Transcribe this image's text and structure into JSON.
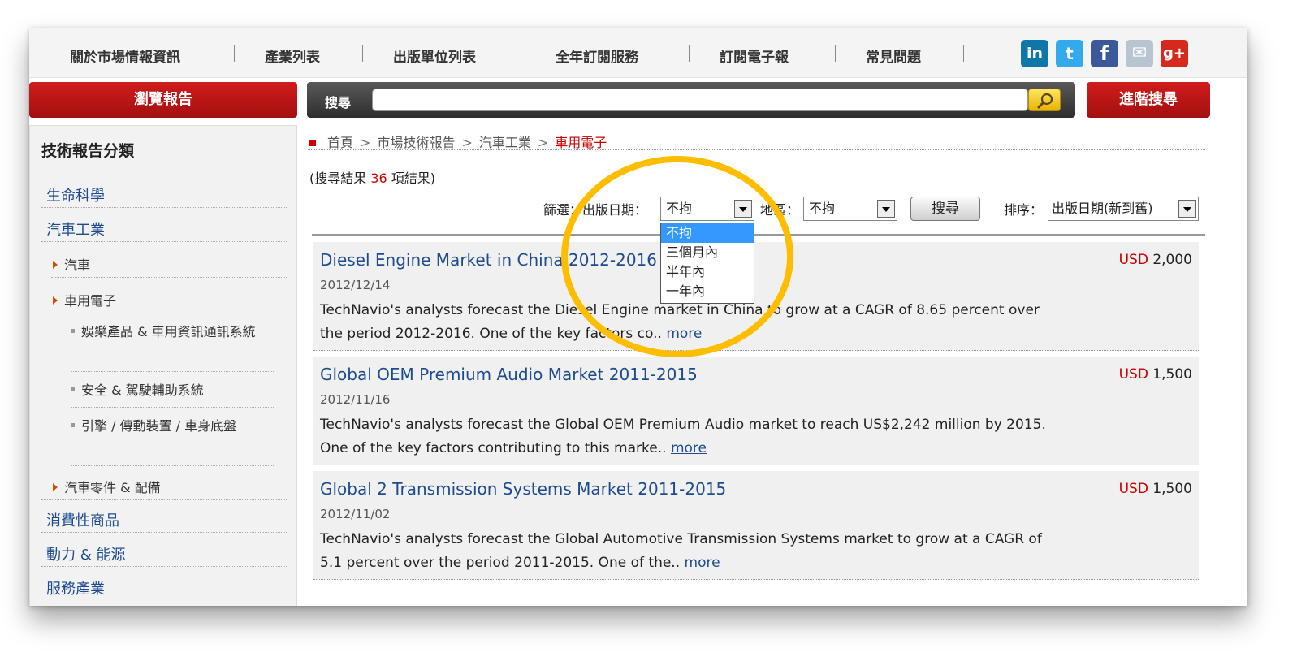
{
  "nav": {
    "items": [
      "關於市場情報資訊",
      "產業列表",
      "出版單位列表",
      "全年訂閱服務",
      "訂閱電子報",
      "常見問題"
    ],
    "social": [
      {
        "name": "linkedin-icon",
        "glyph": "in",
        "color": "#0e76a8"
      },
      {
        "name": "twitter-icon",
        "glyph": "t",
        "color": "#33aaee"
      },
      {
        "name": "facebook-icon",
        "glyph": "f",
        "color": "#3b5998"
      },
      {
        "name": "mail-icon",
        "glyph": "✉",
        "color": "#b8c4d0"
      },
      {
        "name": "google-plus-icon",
        "glyph": "g+",
        "color": "#d6281c"
      }
    ]
  },
  "toolbar": {
    "browse_label": "瀏覽報告",
    "search_label": "搜尋",
    "search_value": "",
    "advanced_label": "進階搜尋"
  },
  "sidebar": {
    "title": "技術報告分類",
    "cat_life": "生命科學",
    "cat_auto": "汽車工業",
    "sub_car": "汽車",
    "sub_elec": "車用電子",
    "sub2_media": "娛樂產品 & 車用資訊通訊系統",
    "sub2_safety": "安全 & 駕駛輔助系統",
    "sub2_engine": "引擎 / 傳動裝置 / 車身底盤",
    "sub_parts": "汽車零件 & 配備",
    "cat_consumer": "消費性商品",
    "cat_power": "動力 & 能源",
    "cat_service": "服務產業"
  },
  "breadcrumb": {
    "home": "首頁",
    "sep": ">",
    "level1": "市場技術報告",
    "level2": "汽車工業",
    "current": "車用電子"
  },
  "results": {
    "count_prefix": "(搜尋結果",
    "count": "36",
    "count_suffix": "項結果)"
  },
  "filter": {
    "label": "篩選：出版日期：",
    "date_value": "不拘",
    "region_label": "地區：",
    "region_value": "不拘",
    "button": "搜尋",
    "sort_label": "排序：",
    "sort_value": "出版日期(新到舊)",
    "date_options": [
      "不拘",
      "三個月內",
      "半年內",
      "一年內"
    ]
  },
  "items": [
    {
      "title": "Diesel Engine Market in China 2012-2016",
      "currency": "USD",
      "amount": "2,000",
      "date": "2012/12/14",
      "desc": "TechNavio's analysts forecast the Diesel Engine market in China to grow at a CAGR of 8.65 percent over the period 2012-2016. One of the key factors co..",
      "more": "more"
    },
    {
      "title": "Global OEM Premium Audio Market 2011-2015",
      "currency": "USD",
      "amount": "1,500",
      "date": "2012/11/16",
      "desc": "TechNavio's analysts forecast the Global OEM Premium Audio market to reach US$2,242 million by 2015. One of the key factors contributing to this marke..",
      "more": "more"
    },
    {
      "title": "Global 2 Transmission Systems Market 2011-2015",
      "currency": "USD",
      "amount": "1,500",
      "date": "2012/11/02",
      "desc": "TechNavio's analysts forecast the Global Automotive Transmission Systems market to grow at a CAGR of 5.1 percent over the period 2011-2015. One of the..",
      "more": "more"
    }
  ],
  "colors": {
    "brand_red": "#c00000",
    "highlight": "#ffbd00",
    "link": "#1e4b8f"
  }
}
